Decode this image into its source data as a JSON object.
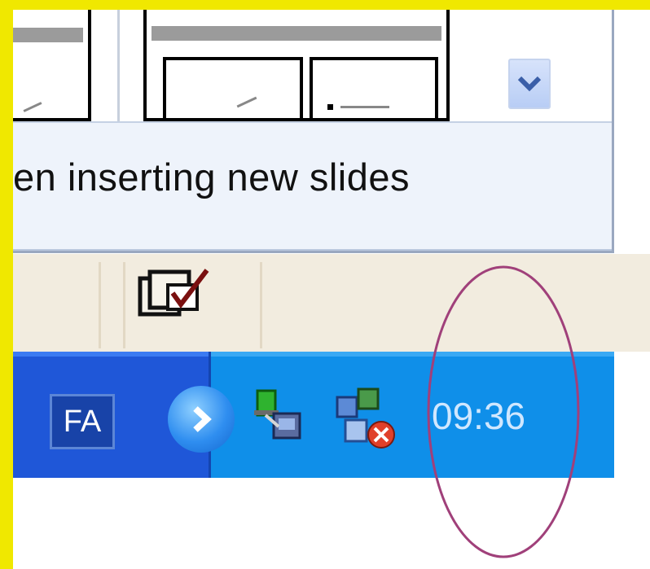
{
  "task_pane": {
    "hint_text": "en inserting new slides"
  },
  "taskbar": {
    "language": "FA",
    "clock": "09:36"
  },
  "icons": {
    "scroll": "chevron-down-icon",
    "spelling": "spelling-check-icon",
    "tray_expand": "tray-expand-icon",
    "network": "network-icon",
    "network_error": "network-disconnected-icon"
  },
  "colors": {
    "frame": "#f0e800",
    "taskbar": "#1f57d8",
    "tray": "#0f8fe9",
    "annotation": "#a0407a"
  }
}
